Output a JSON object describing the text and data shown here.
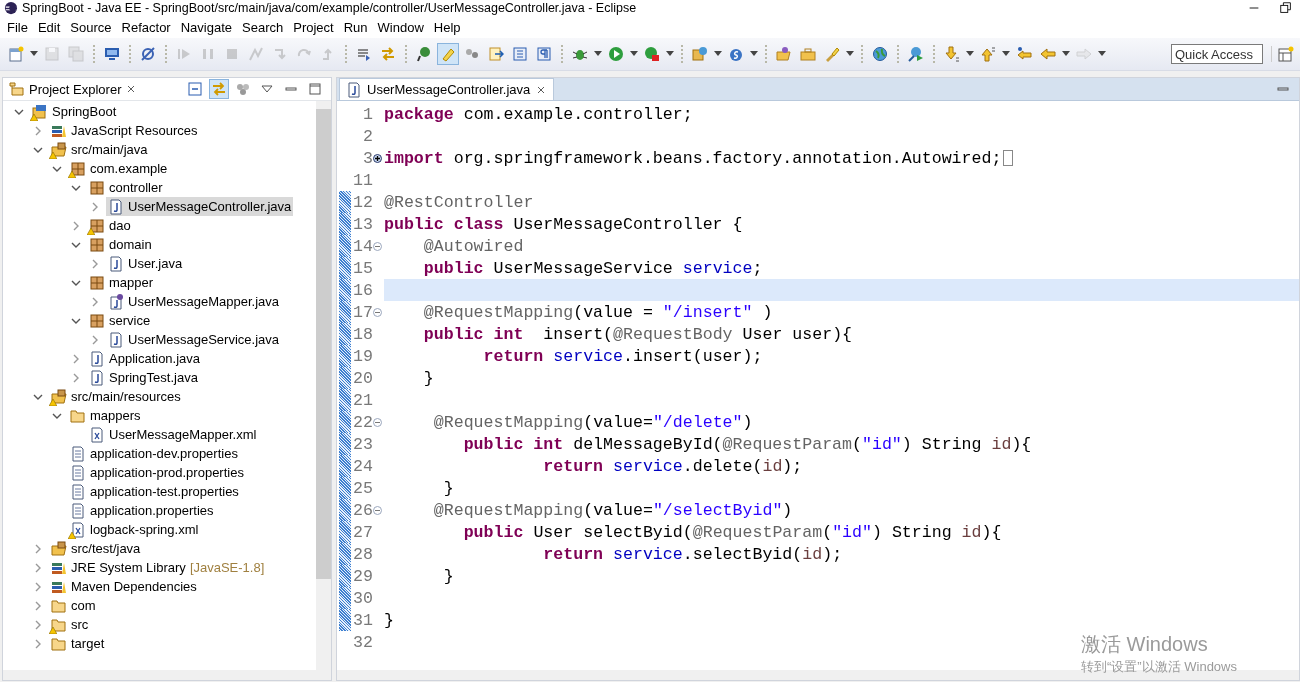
{
  "window": {
    "title": "SpringBoot - Java EE - SpringBoot/src/main/java/com/example/controller/UserMessageController.java - Eclipse"
  },
  "menu": [
    {
      "label": "File"
    },
    {
      "label": "Edit"
    },
    {
      "label": "Source"
    },
    {
      "label": "Refactor"
    },
    {
      "label": "Navigate"
    },
    {
      "label": "Search"
    },
    {
      "label": "Project"
    },
    {
      "label": "Run"
    },
    {
      "label": "Window"
    },
    {
      "label": "Help"
    }
  ],
  "toolbar": [
    [
      {
        "kind": "new",
        "dropdown": true,
        "disabled": false,
        "pressed": false
      },
      {
        "kind": "save",
        "dropdown": false,
        "disabled": true,
        "pressed": false
      },
      {
        "kind": "saveall",
        "dropdown": false,
        "disabled": true,
        "pressed": false
      }
    ],
    [
      {
        "kind": "monitor",
        "dropdown": false,
        "disabled": false,
        "pressed": false
      }
    ],
    [
      {
        "kind": "skip",
        "dropdown": false,
        "disabled": false,
        "pressed": false
      }
    ],
    [
      {
        "kind": "resume",
        "dropdown": false,
        "disabled": true,
        "pressed": false
      },
      {
        "kind": "suspend",
        "dropdown": false,
        "disabled": true,
        "pressed": false
      },
      {
        "kind": "terminate",
        "dropdown": false,
        "disabled": true,
        "pressed": false
      },
      {
        "kind": "disconnect",
        "dropdown": false,
        "disabled": true,
        "pressed": false
      },
      {
        "kind": "stepinto",
        "dropdown": false,
        "disabled": true,
        "pressed": false
      },
      {
        "kind": "stepover",
        "dropdown": false,
        "disabled": true,
        "pressed": false
      },
      {
        "kind": "stepreturn",
        "dropdown": false,
        "disabled": true,
        "pressed": false
      }
    ],
    [
      {
        "kind": "dropframe",
        "dropdown": false,
        "disabled": false,
        "pressed": false
      },
      {
        "kind": "stepfilter",
        "dropdown": false,
        "disabled": false,
        "pressed": false
      }
    ],
    [
      {
        "kind": "pin",
        "dropdown": false,
        "disabled": false,
        "pressed": false
      },
      {
        "kind": "highlight",
        "dropdown": false,
        "disabled": false,
        "pressed": true
      },
      {
        "kind": "paw",
        "dropdown": false,
        "disabled": false,
        "pressed": false
      },
      {
        "kind": "annotation",
        "dropdown": false,
        "disabled": false,
        "pressed": false
      },
      {
        "kind": "block",
        "dropdown": false,
        "disabled": false,
        "pressed": false
      },
      {
        "kind": "whitespace",
        "dropdown": false,
        "disabled": false,
        "pressed": false
      }
    ],
    [
      {
        "kind": "debug",
        "dropdown": true,
        "disabled": false,
        "pressed": false
      },
      {
        "kind": "run",
        "dropdown": true,
        "disabled": false,
        "pressed": false
      },
      {
        "kind": "tools",
        "dropdown": true,
        "disabled": false,
        "pressed": false
      }
    ],
    [
      {
        "kind": "server",
        "dropdown": true,
        "disabled": false,
        "pressed": false
      },
      {
        "kind": "spring",
        "dropdown": true,
        "disabled": false,
        "pressed": false
      }
    ],
    [
      {
        "kind": "opentype",
        "dropdown": false,
        "disabled": false,
        "pressed": false
      },
      {
        "kind": "opentask",
        "dropdown": false,
        "disabled": false,
        "pressed": false
      },
      {
        "kind": "search",
        "dropdown": true,
        "disabled": false,
        "pressed": false
      }
    ],
    [
      {
        "kind": "globe",
        "dropdown": false,
        "disabled": false,
        "pressed": false
      }
    ],
    [
      {
        "kind": "webrun",
        "dropdown": false,
        "disabled": false,
        "pressed": false
      }
    ],
    [
      {
        "kind": "nextann",
        "dropdown": true,
        "disabled": false,
        "pressed": false
      },
      {
        "kind": "prevann",
        "dropdown": true,
        "disabled": false,
        "pressed": false
      },
      {
        "kind": "lastedit",
        "dropdown": false,
        "disabled": false,
        "pressed": false
      },
      {
        "kind": "back",
        "dropdown": true,
        "disabled": false,
        "pressed": false
      },
      {
        "kind": "forward",
        "dropdown": true,
        "disabled": true,
        "pressed": false
      }
    ]
  ],
  "quick_access": {
    "placeholder": "Quick Access"
  },
  "explorer": {
    "title": "Project Explorer",
    "link_with_editor": true,
    "tree": [
      {
        "label": "SpringBoot",
        "kind": "project",
        "expanded": true,
        "warning": true,
        "selected": false,
        "children": [
          {
            "label": "JavaScript Resources",
            "kind": "library",
            "expanded": false,
            "warning": false,
            "selected": false
          },
          {
            "label": "src/main/java",
            "kind": "source-folder",
            "expanded": true,
            "warning": true,
            "selected": false,
            "children": [
              {
                "label": "com.example",
                "kind": "package",
                "expanded": true,
                "warning": true,
                "selected": false,
                "children": [
                  {
                    "label": "controller",
                    "kind": "package",
                    "expanded": true,
                    "warning": false,
                    "selected": false,
                    "children": [
                      {
                        "label": "UserMessageController.java",
                        "kind": "java",
                        "expanded": false,
                        "warning": false,
                        "selected": true
                      }
                    ]
                  },
                  {
                    "label": "dao",
                    "kind": "package",
                    "expanded": false,
                    "warning": true,
                    "selected": false
                  },
                  {
                    "label": "domain",
                    "kind": "package",
                    "expanded": true,
                    "warning": false,
                    "selected": false,
                    "children": [
                      {
                        "label": "User.java",
                        "kind": "java",
                        "expanded": false,
                        "warning": false,
                        "selected": false
                      }
                    ]
                  },
                  {
                    "label": "mapper",
                    "kind": "package",
                    "expanded": true,
                    "warning": false,
                    "selected": false,
                    "children": [
                      {
                        "label": "UserMessageMapper.java",
                        "kind": "interface",
                        "expanded": false,
                        "warning": false,
                        "selected": false
                      }
                    ]
                  },
                  {
                    "label": "service",
                    "kind": "package",
                    "expanded": true,
                    "warning": false,
                    "selected": false,
                    "children": [
                      {
                        "label": "UserMessageService.java",
                        "kind": "java",
                        "expanded": false,
                        "warning": false,
                        "selected": false
                      }
                    ]
                  },
                  {
                    "label": "Application.java",
                    "kind": "java",
                    "expanded": false,
                    "warning": false,
                    "selected": false
                  },
                  {
                    "label": "SpringTest.java",
                    "kind": "java",
                    "expanded": false,
                    "warning": false,
                    "selected": false
                  }
                ]
              }
            ]
          },
          {
            "label": "src/main/resources",
            "kind": "source-folder",
            "expanded": true,
            "warning": true,
            "selected": false,
            "children": [
              {
                "label": "mappers",
                "kind": "folder",
                "expanded": true,
                "warning": false,
                "selected": false,
                "children": [
                  {
                    "label": "UserMessageMapper.xml",
                    "kind": "xml",
                    "warning": false,
                    "selected": false
                  }
                ]
              },
              {
                "label": "application-dev.properties",
                "kind": "properties",
                "warning": false,
                "selected": false
              },
              {
                "label": "application-prod.properties",
                "kind": "properties",
                "warning": false,
                "selected": false
              },
              {
                "label": "application-test.properties",
                "kind": "properties",
                "warning": false,
                "selected": false
              },
              {
                "label": "application.properties",
                "kind": "properties",
                "warning": false,
                "selected": false
              },
              {
                "label": "logback-spring.xml",
                "kind": "xml",
                "warning": true,
                "selected": false
              }
            ]
          },
          {
            "label": "src/test/java",
            "kind": "source-folder",
            "expanded": false,
            "warning": false,
            "selected": false
          },
          {
            "label": "JRE System Library",
            "decoration": "[JavaSE-1.8]",
            "kind": "library",
            "expanded": false,
            "warning": false,
            "selected": false
          },
          {
            "label": "Maven Dependencies",
            "kind": "library",
            "expanded": false,
            "warning": false,
            "selected": false
          },
          {
            "label": "com",
            "kind": "folder",
            "expanded": false,
            "warning": false,
            "selected": false
          },
          {
            "label": "src",
            "kind": "folder",
            "expanded": false,
            "warning": true,
            "selected": false
          },
          {
            "label": "target",
            "kind": "folder",
            "expanded": false,
            "warning": false,
            "selected": false
          }
        ]
      }
    ]
  },
  "editor": {
    "tab": "UserMessageController.java",
    "lines": [
      {
        "number": "1",
        "changed": false,
        "current": false,
        "tokens": [
          {
            "kind": "keyword",
            "text": "package"
          },
          {
            "kind": "plain",
            "text": " com.example.controller;"
          }
        ]
      },
      {
        "number": "2",
        "changed": false,
        "current": false
      },
      {
        "number": "3",
        "folded": true,
        "changed": false,
        "current": false,
        "tokens": [
          {
            "kind": "keyword",
            "text": "import"
          },
          {
            "kind": "plain",
            "text": " org.springframework.beans.factory.annotation.Autowired;"
          }
        ]
      },
      {
        "number": "11",
        "changed": false,
        "current": false
      },
      {
        "number": "12",
        "changed": true,
        "current": false,
        "tokens": [
          {
            "kind": "annotation",
            "text": "@RestController"
          }
        ]
      },
      {
        "number": "13",
        "changed": true,
        "current": false,
        "tokens": [
          {
            "kind": "keyword",
            "text": "public class"
          },
          {
            "kind": "plain",
            "text": " UserMessageController {"
          }
        ]
      },
      {
        "number": "14",
        "folded": false,
        "changed": true,
        "current": false,
        "tokens": [
          {
            "kind": "annotation",
            "text": "    @Autowired"
          }
        ]
      },
      {
        "number": "15",
        "changed": true,
        "current": false,
        "tokens": [
          {
            "kind": "keyword",
            "text": "    public"
          },
          {
            "kind": "plain",
            "text": " UserMessageService "
          },
          {
            "kind": "field",
            "text": "service"
          },
          {
            "kind": "plain",
            "text": ";"
          }
        ]
      },
      {
        "number": "16",
        "changed": true,
        "current": true
      },
      {
        "number": "17",
        "folded": false,
        "changed": true,
        "current": false,
        "tokens": [
          {
            "kind": "annotation",
            "text": "    @RequestMapping"
          },
          {
            "kind": "plain",
            "text": "(value = "
          },
          {
            "kind": "string",
            "text": "\"/insert\""
          },
          {
            "kind": "plain",
            "text": " )"
          }
        ]
      },
      {
        "number": "18",
        "changed": true,
        "current": false,
        "tokens": [
          {
            "kind": "keyword",
            "text": "    public int"
          },
          {
            "kind": "plain",
            "text": "  insert("
          },
          {
            "kind": "annotation",
            "text": "@RequestBody"
          },
          {
            "kind": "plain",
            "text": " User user){"
          }
        ]
      },
      {
        "number": "19",
        "changed": true,
        "current": false,
        "tokens": [
          {
            "kind": "keyword",
            "text": "          return "
          },
          {
            "kind": "field",
            "text": "service"
          },
          {
            "kind": "plain",
            "text": ".insert(user);"
          }
        ]
      },
      {
        "number": "20",
        "changed": true,
        "current": false,
        "tokens": [
          {
            "kind": "plain",
            "text": "    }"
          }
        ]
      },
      {
        "number": "21",
        "changed": true,
        "current": false
      },
      {
        "number": "22",
        "folded": false,
        "changed": true,
        "current": false,
        "tokens": [
          {
            "kind": "annotation",
            "text": "     @RequestMapping"
          },
          {
            "kind": "plain",
            "text": "(value="
          },
          {
            "kind": "string",
            "text": "\"/delete\""
          },
          {
            "kind": "plain",
            "text": ")"
          }
        ]
      },
      {
        "number": "23",
        "changed": true,
        "current": false,
        "tokens": [
          {
            "kind": "keyword",
            "text": "        public int"
          },
          {
            "kind": "plain",
            "text": " delMessageById("
          },
          {
            "kind": "annotation",
            "text": "@RequestParam"
          },
          {
            "kind": "plain",
            "text": "("
          },
          {
            "kind": "string",
            "text": "\"id\""
          },
          {
            "kind": "plain",
            "text": ") String "
          },
          {
            "kind": "parameter",
            "text": "id"
          },
          {
            "kind": "plain",
            "text": "){"
          }
        ]
      },
      {
        "number": "24",
        "changed": true,
        "current": false,
        "tokens": [
          {
            "kind": "keyword",
            "text": "                return "
          },
          {
            "kind": "field",
            "text": "service"
          },
          {
            "kind": "plain",
            "text": ".delete("
          },
          {
            "kind": "parameter",
            "text": "id"
          },
          {
            "kind": "plain",
            "text": ");"
          }
        ]
      },
      {
        "number": "25",
        "changed": true,
        "current": false,
        "tokens": [
          {
            "kind": "plain",
            "text": "      }"
          }
        ]
      },
      {
        "number": "26",
        "folded": false,
        "changed": true,
        "current": false,
        "tokens": [
          {
            "kind": "annotation",
            "text": "     @RequestMapping"
          },
          {
            "kind": "plain",
            "text": "(value="
          },
          {
            "kind": "string",
            "text": "\"/selectByid\""
          },
          {
            "kind": "plain",
            "text": ")"
          }
        ]
      },
      {
        "number": "27",
        "changed": true,
        "current": false,
        "tokens": [
          {
            "kind": "keyword",
            "text": "        public"
          },
          {
            "kind": "plain",
            "text": " User selectByid("
          },
          {
            "kind": "annotation",
            "text": "@RequestParam"
          },
          {
            "kind": "plain",
            "text": "("
          },
          {
            "kind": "string",
            "text": "\"id\""
          },
          {
            "kind": "plain",
            "text": ") String "
          },
          {
            "kind": "parameter",
            "text": "id"
          },
          {
            "kind": "plain",
            "text": "){"
          }
        ]
      },
      {
        "number": "28",
        "changed": true,
        "current": false,
        "tokens": [
          {
            "kind": "keyword",
            "text": "                return "
          },
          {
            "kind": "field",
            "text": "service"
          },
          {
            "kind": "plain",
            "text": ".selectByid("
          },
          {
            "kind": "parameter",
            "text": "id"
          },
          {
            "kind": "plain",
            "text": ");"
          }
        ]
      },
      {
        "number": "29",
        "changed": true,
        "current": false,
        "tokens": [
          {
            "kind": "plain",
            "text": "      }"
          }
        ]
      },
      {
        "number": "30",
        "changed": true,
        "current": false
      },
      {
        "number": "31",
        "changed": true,
        "current": false,
        "tokens": [
          {
            "kind": "plain",
            "text": "}"
          }
        ]
      },
      {
        "number": "32",
        "changed": false,
        "current": false
      }
    ]
  },
  "os_notice": {
    "title": "激活 Windows",
    "hint": "转到“设置”以激活 Windows"
  }
}
